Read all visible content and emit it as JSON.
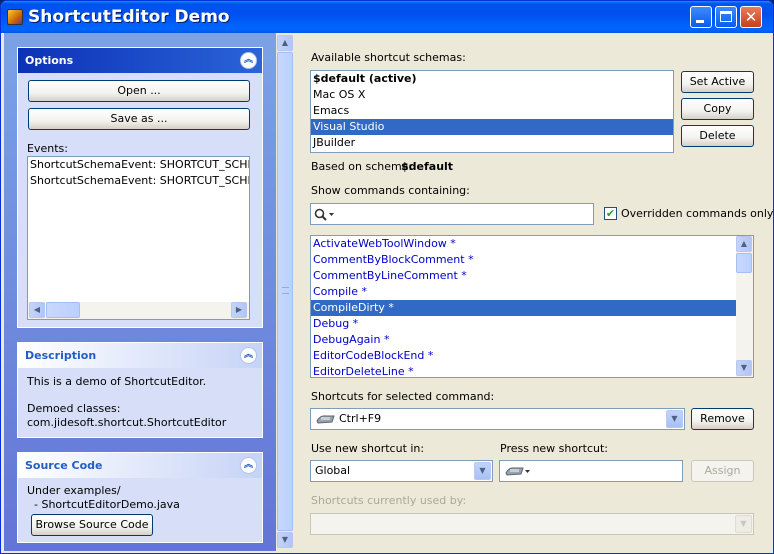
{
  "window": {
    "title": "ShortcutEditor Demo"
  },
  "options": {
    "header": "Options",
    "open_label": "Open ...",
    "save_as_label": "Save as ...",
    "events_label": "Events:",
    "events": [
      "ShortcutSchemaEvent: SHORTCUT_SCHEMA_",
      "ShortcutSchemaEvent: SHORTCUT_SCHEMA_"
    ]
  },
  "description": {
    "header": "Description",
    "line1": "This is a demo of ShortcutEditor.",
    "line2": "Demoed classes:",
    "line3": "com.jidesoft.shortcut.ShortcutEditor"
  },
  "source_code": {
    "header": "Source Code",
    "line1": "Under examples/",
    "line2": "  - ShortcutEditorDemo.java",
    "browse_label": "Browse Source Code"
  },
  "schemas": {
    "label": "Available shortcut schemas:",
    "items": [
      "$default (active)",
      "Mac OS X",
      "Emacs",
      "Visual Studio",
      "JBuilder"
    ],
    "selected_index": 3,
    "set_active_label": "Set Active",
    "copy_label": "Copy",
    "delete_label": "Delete",
    "based_on_label": "Based on schema:",
    "based_on_value": "$default"
  },
  "commands": {
    "label": "Show commands containing:",
    "search_value": "",
    "overridden_label": "Overridden commands only",
    "overridden_checked": true,
    "items": [
      "ActivateWebToolWindow *",
      "CommentByBlockComment *",
      "CommentByLineComment *",
      "Compile *",
      "CompileDirty *",
      "Debug *",
      "DebugAgain *",
      "EditorCodeBlockEnd *",
      "EditorDeleteLine *"
    ],
    "selected_index": 4
  },
  "shortcuts": {
    "label": "Shortcuts for selected command:",
    "value": "Ctrl+F9",
    "remove_label": "Remove",
    "use_in_label": "Use new shortcut in:",
    "use_in_value": "Global",
    "press_label": "Press new shortcut:",
    "assign_label": "Assign",
    "used_by_label": "Shortcuts currently used by:"
  },
  "colors": {
    "accent": "#316ac5",
    "title_blue": "#0053ee",
    "command_text": "#0000c8"
  }
}
